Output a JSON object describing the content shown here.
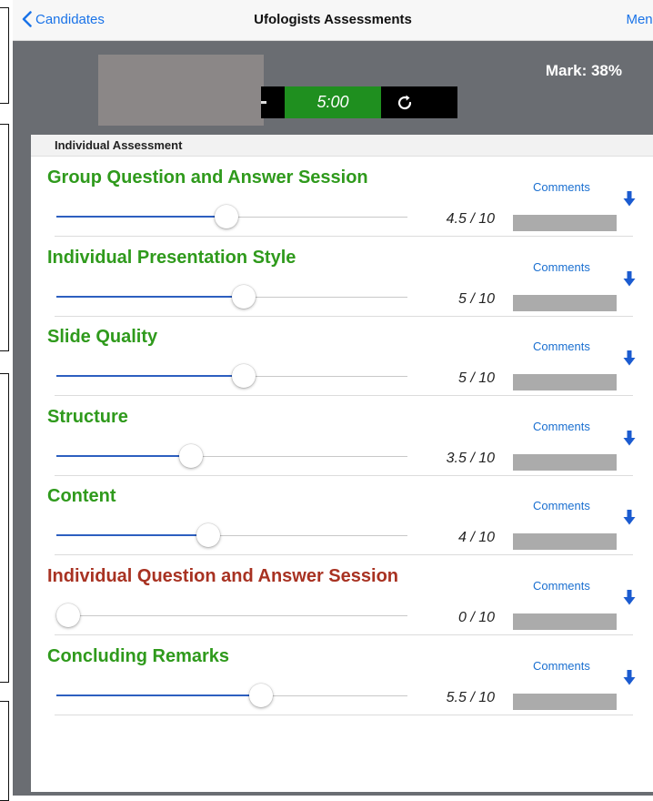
{
  "navbar": {
    "back_label": "Candidates",
    "title": "Ufologists Assessments",
    "menu_label": "Menu"
  },
  "header": {
    "timer": "5:00",
    "mark": "Mark: 38%"
  },
  "section": {
    "title": "Individual Assessment"
  },
  "comments_label": "Comments",
  "colors": {
    "accent": "#1a73e8",
    "good": "#2f9a1c",
    "bad": "#a83222",
    "timer_bg": "#1f8f1f",
    "slider_fill": "#2d5fc0"
  },
  "criteria": [
    {
      "title": "Group Question and Answer Session",
      "value": 4.5,
      "max": 10,
      "score_text": "4.5 / 10",
      "status": "good"
    },
    {
      "title": "Individual Presentation Style",
      "value": 5,
      "max": 10,
      "score_text": "5 / 10",
      "status": "good"
    },
    {
      "title": "Slide Quality",
      "value": 5,
      "max": 10,
      "score_text": "5 / 10",
      "status": "good"
    },
    {
      "title": "Structure",
      "value": 3.5,
      "max": 10,
      "score_text": "3.5 / 10",
      "status": "good"
    },
    {
      "title": "Content",
      "value": 4,
      "max": 10,
      "score_text": "4 / 10",
      "status": "good"
    },
    {
      "title": "Individual Question and Answer Session",
      "value": 0,
      "max": 10,
      "score_text": "0 / 10",
      "status": "bad"
    },
    {
      "title": "Concluding Remarks",
      "value": 5.5,
      "max": 10,
      "score_text": "5.5 / 10",
      "status": "good"
    }
  ]
}
